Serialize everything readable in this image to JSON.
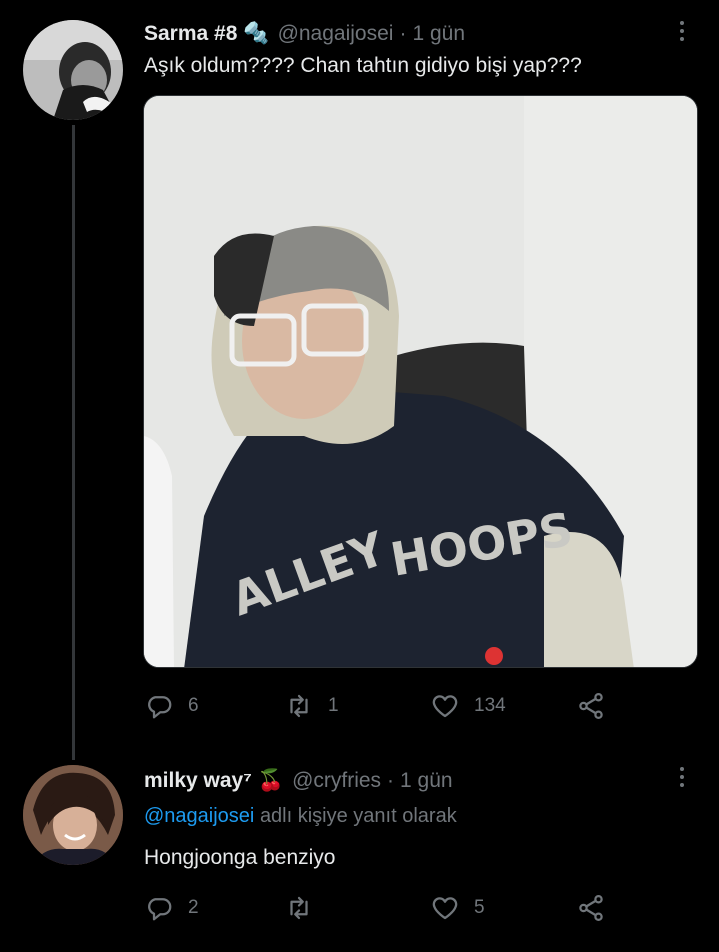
{
  "tweet1": {
    "display_name": "Sarma #8",
    "name_emoji": "🔩",
    "handle": "@nagaijosei",
    "separator": "·",
    "time": "1 gün",
    "text": "Aşık oldum???? Chan tahtın gidiyo bişi yap???",
    "actions": {
      "reply_count": "6",
      "retweet_count": "1",
      "like_count": "134"
    }
  },
  "tweet2": {
    "display_name": "milky way⁷",
    "name_emoji": "🍒",
    "handle": "@cryfries",
    "separator": "·",
    "time": "1 gün",
    "reply_to_handle": "@nagaijosei",
    "reply_to_suffix": "adlı kişiye yanıt olarak",
    "text": "Hongjoonga benziyo",
    "actions": {
      "reply_count": "2",
      "retweet_count": "",
      "like_count": "5"
    }
  },
  "colors": {
    "background": "#000000",
    "text_primary": "#e7e9ea",
    "text_secondary": "#71767b",
    "link": "#1d9bf0",
    "thread_line": "#333639"
  }
}
